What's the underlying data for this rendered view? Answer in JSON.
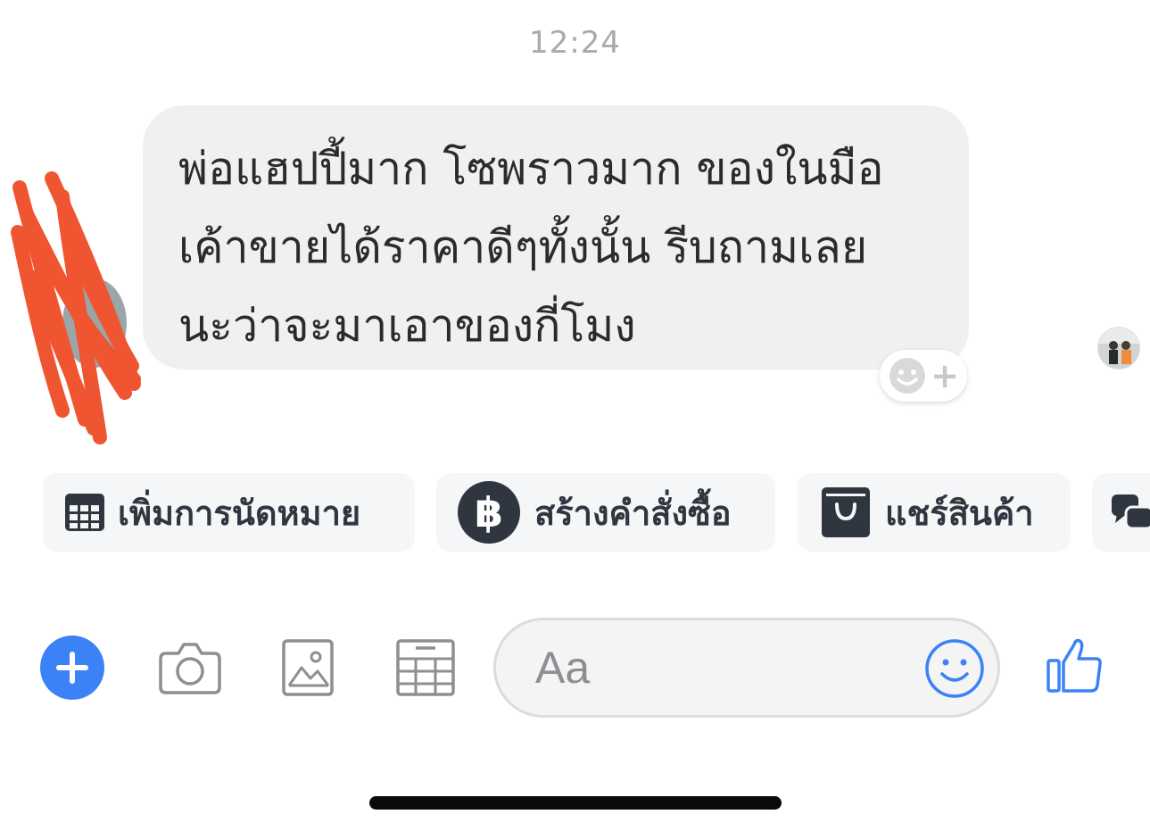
{
  "timestamp": "12:24",
  "message": {
    "lines": [
      "พ่อแฮปปี้มาก โซพราวมาก ของในมือ",
      "เค้าขายได้ราคาดีๆทั้งนั้น รีบถามเลย",
      "นะว่าจะมาเอาของกี่โมง"
    ]
  },
  "reaction": {
    "plus": "+"
  },
  "quick_actions": [
    {
      "label": "เพิ่มการนัดหมาย",
      "icon": "calendar-icon"
    },
    {
      "label": "สร้างคำสั่งซื้อ",
      "icon": "baht-icon"
    },
    {
      "label": "แชร์สินค้า",
      "icon": "shop-bag-icon"
    }
  ],
  "composer": {
    "placeholder": "Aa",
    "icons": [
      "plus-icon",
      "camera-icon",
      "photo-icon",
      "calendar-icon",
      "emoji-icon",
      "like-icon"
    ]
  },
  "colors": {
    "accent_blue": "#3b82f6",
    "redaction": "#ef5530",
    "chip_icon": "#2f3640"
  }
}
